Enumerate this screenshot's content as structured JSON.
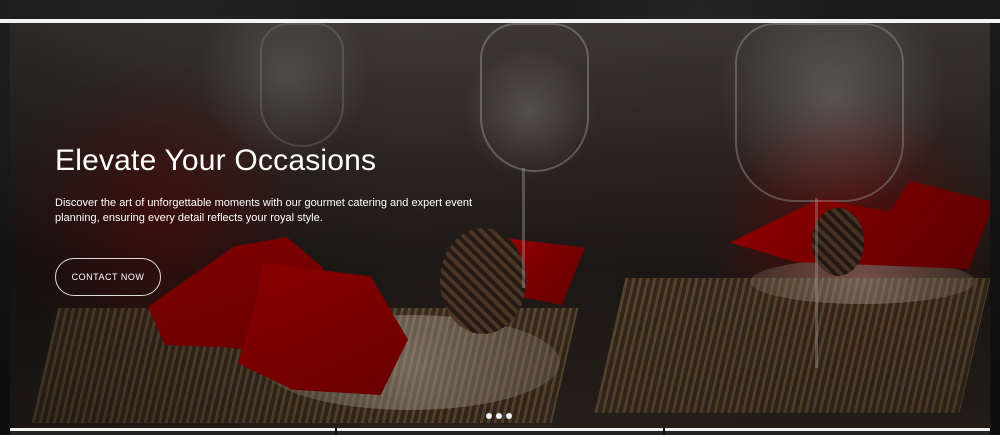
{
  "hero": {
    "title": "Elevate Your Occasions",
    "description": "Discover the art of unforgettable moments with our gourmet catering and expert event planning, ensuring every detail reflects your royal style.",
    "cta_label": "CONTACT NOW"
  },
  "colors": {
    "accent_white": "#ffffff",
    "accent_red": "#c00000"
  }
}
